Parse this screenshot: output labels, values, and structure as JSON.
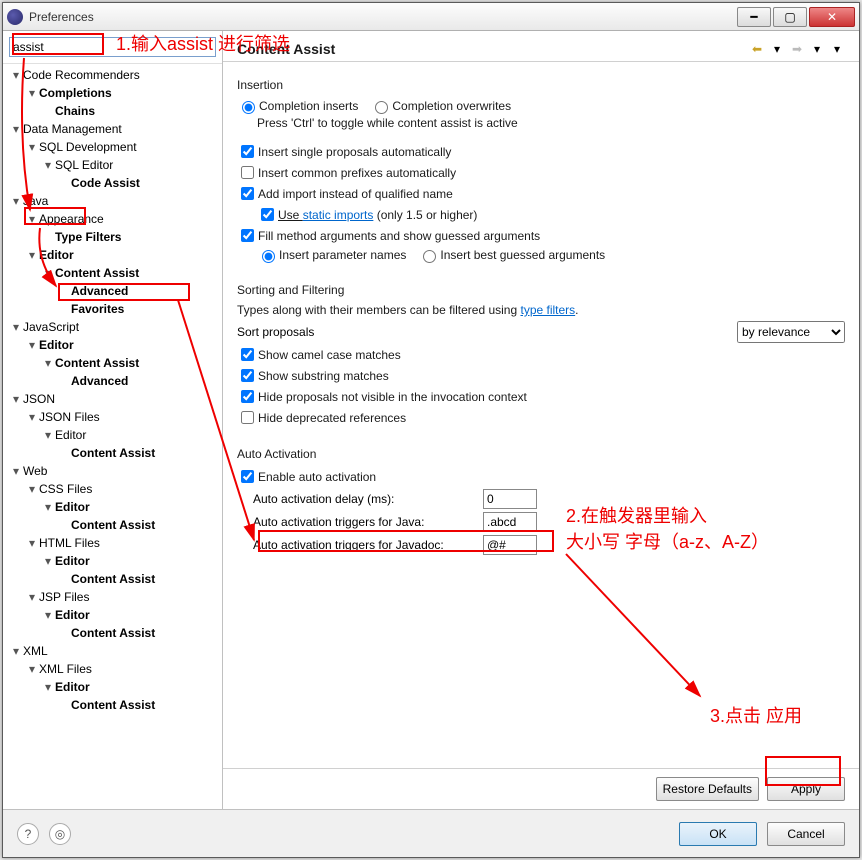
{
  "window": {
    "title": "Preferences"
  },
  "filter": {
    "value": "assist"
  },
  "tree": [
    {
      "d": 0,
      "e": true,
      "l": "Code Recommenders"
    },
    {
      "d": 1,
      "e": true,
      "l": "Completions",
      "b": true
    },
    {
      "d": 2,
      "e": false,
      "l": "Chains",
      "b": true
    },
    {
      "d": 0,
      "e": true,
      "l": "Data Management"
    },
    {
      "d": 1,
      "e": true,
      "l": "SQL Development"
    },
    {
      "d": 2,
      "e": true,
      "l": "SQL Editor"
    },
    {
      "d": 3,
      "e": false,
      "l": "Code Assist",
      "b": true
    },
    {
      "d": 0,
      "e": true,
      "l": "Java",
      "boxTarget": "java"
    },
    {
      "d": 1,
      "e": true,
      "l": "Appearance"
    },
    {
      "d": 2,
      "e": false,
      "l": "Type Filters",
      "b": true
    },
    {
      "d": 1,
      "e": true,
      "l": "Editor",
      "b": true
    },
    {
      "d": 2,
      "e": true,
      "l": "Content Assist",
      "b": true,
      "boxTarget": "ca"
    },
    {
      "d": 3,
      "e": false,
      "l": "Advanced",
      "b": true
    },
    {
      "d": 3,
      "e": false,
      "l": "Favorites",
      "b": true
    },
    {
      "d": 0,
      "e": true,
      "l": "JavaScript"
    },
    {
      "d": 1,
      "e": true,
      "l": "Editor",
      "b": true
    },
    {
      "d": 2,
      "e": true,
      "l": "Content Assist",
      "b": true
    },
    {
      "d": 3,
      "e": false,
      "l": "Advanced",
      "b": true
    },
    {
      "d": 0,
      "e": true,
      "l": "JSON"
    },
    {
      "d": 1,
      "e": true,
      "l": "JSON Files"
    },
    {
      "d": 2,
      "e": true,
      "l": "Editor"
    },
    {
      "d": 3,
      "e": false,
      "l": "Content Assist",
      "b": true
    },
    {
      "d": 0,
      "e": true,
      "l": "Web"
    },
    {
      "d": 1,
      "e": true,
      "l": "CSS Files"
    },
    {
      "d": 2,
      "e": true,
      "l": "Editor",
      "b": true
    },
    {
      "d": 3,
      "e": false,
      "l": "Content Assist",
      "b": true
    },
    {
      "d": 1,
      "e": true,
      "l": "HTML Files"
    },
    {
      "d": 2,
      "e": true,
      "l": "Editor",
      "b": true
    },
    {
      "d": 3,
      "e": false,
      "l": "Content Assist",
      "b": true
    },
    {
      "d": 1,
      "e": true,
      "l": "JSP Files"
    },
    {
      "d": 2,
      "e": true,
      "l": "Editor",
      "b": true
    },
    {
      "d": 3,
      "e": false,
      "l": "Content Assist",
      "b": true
    },
    {
      "d": 0,
      "e": true,
      "l": "XML"
    },
    {
      "d": 1,
      "e": true,
      "l": "XML Files"
    },
    {
      "d": 2,
      "e": true,
      "l": "Editor",
      "b": true
    },
    {
      "d": 3,
      "e": false,
      "l": "Content Assist",
      "b": true
    }
  ],
  "page_title": "Content Assist",
  "insertion": {
    "title": "Insertion",
    "inserts": "Completion inserts",
    "overwrites": "Completion overwrites",
    "hint": "Press 'Ctrl' to toggle while content assist is active",
    "single": "Insert single proposals automatically",
    "prefix": "Insert common prefixes automatically",
    "addimport": "Add import instead of qualified name",
    "static_pre": "Use ",
    "static_link": "static imports",
    "static_post": " (only 1.5 or higher)",
    "fill": "Fill method arguments and show guessed arguments",
    "params": "Insert parameter names",
    "best": "Insert best guessed arguments"
  },
  "sorting": {
    "title": "Sorting and Filtering",
    "hint_pre": "Types along with their members can be filtered using ",
    "hint_link": "type filters",
    "sort_label": "Sort proposals",
    "sort_value": "by relevance",
    "camel": "Show camel case matches",
    "substr": "Show substring matches",
    "hide": "Hide proposals not visible in the invocation context",
    "deprecated": "Hide deprecated references"
  },
  "auto": {
    "title": "Auto Activation",
    "enable": "Enable auto activation",
    "delay_l": "Auto activation delay (ms):",
    "delay_v": "0",
    "java_l": "Auto activation triggers for Java:",
    "java_v": ".abcd",
    "jdoc_l": "Auto activation triggers for Javadoc:",
    "jdoc_v": "@#"
  },
  "buttons": {
    "restore": "Restore Defaults",
    "apply": "Apply",
    "ok": "OK",
    "cancel": "Cancel"
  },
  "annotations": {
    "a1": "1.输入assist 进行筛选",
    "a2_l1": "2.在触发器里输入",
    "a2_l2": "大小写 字母（a-z、A-Z）",
    "a3": "3.点击 应用"
  }
}
